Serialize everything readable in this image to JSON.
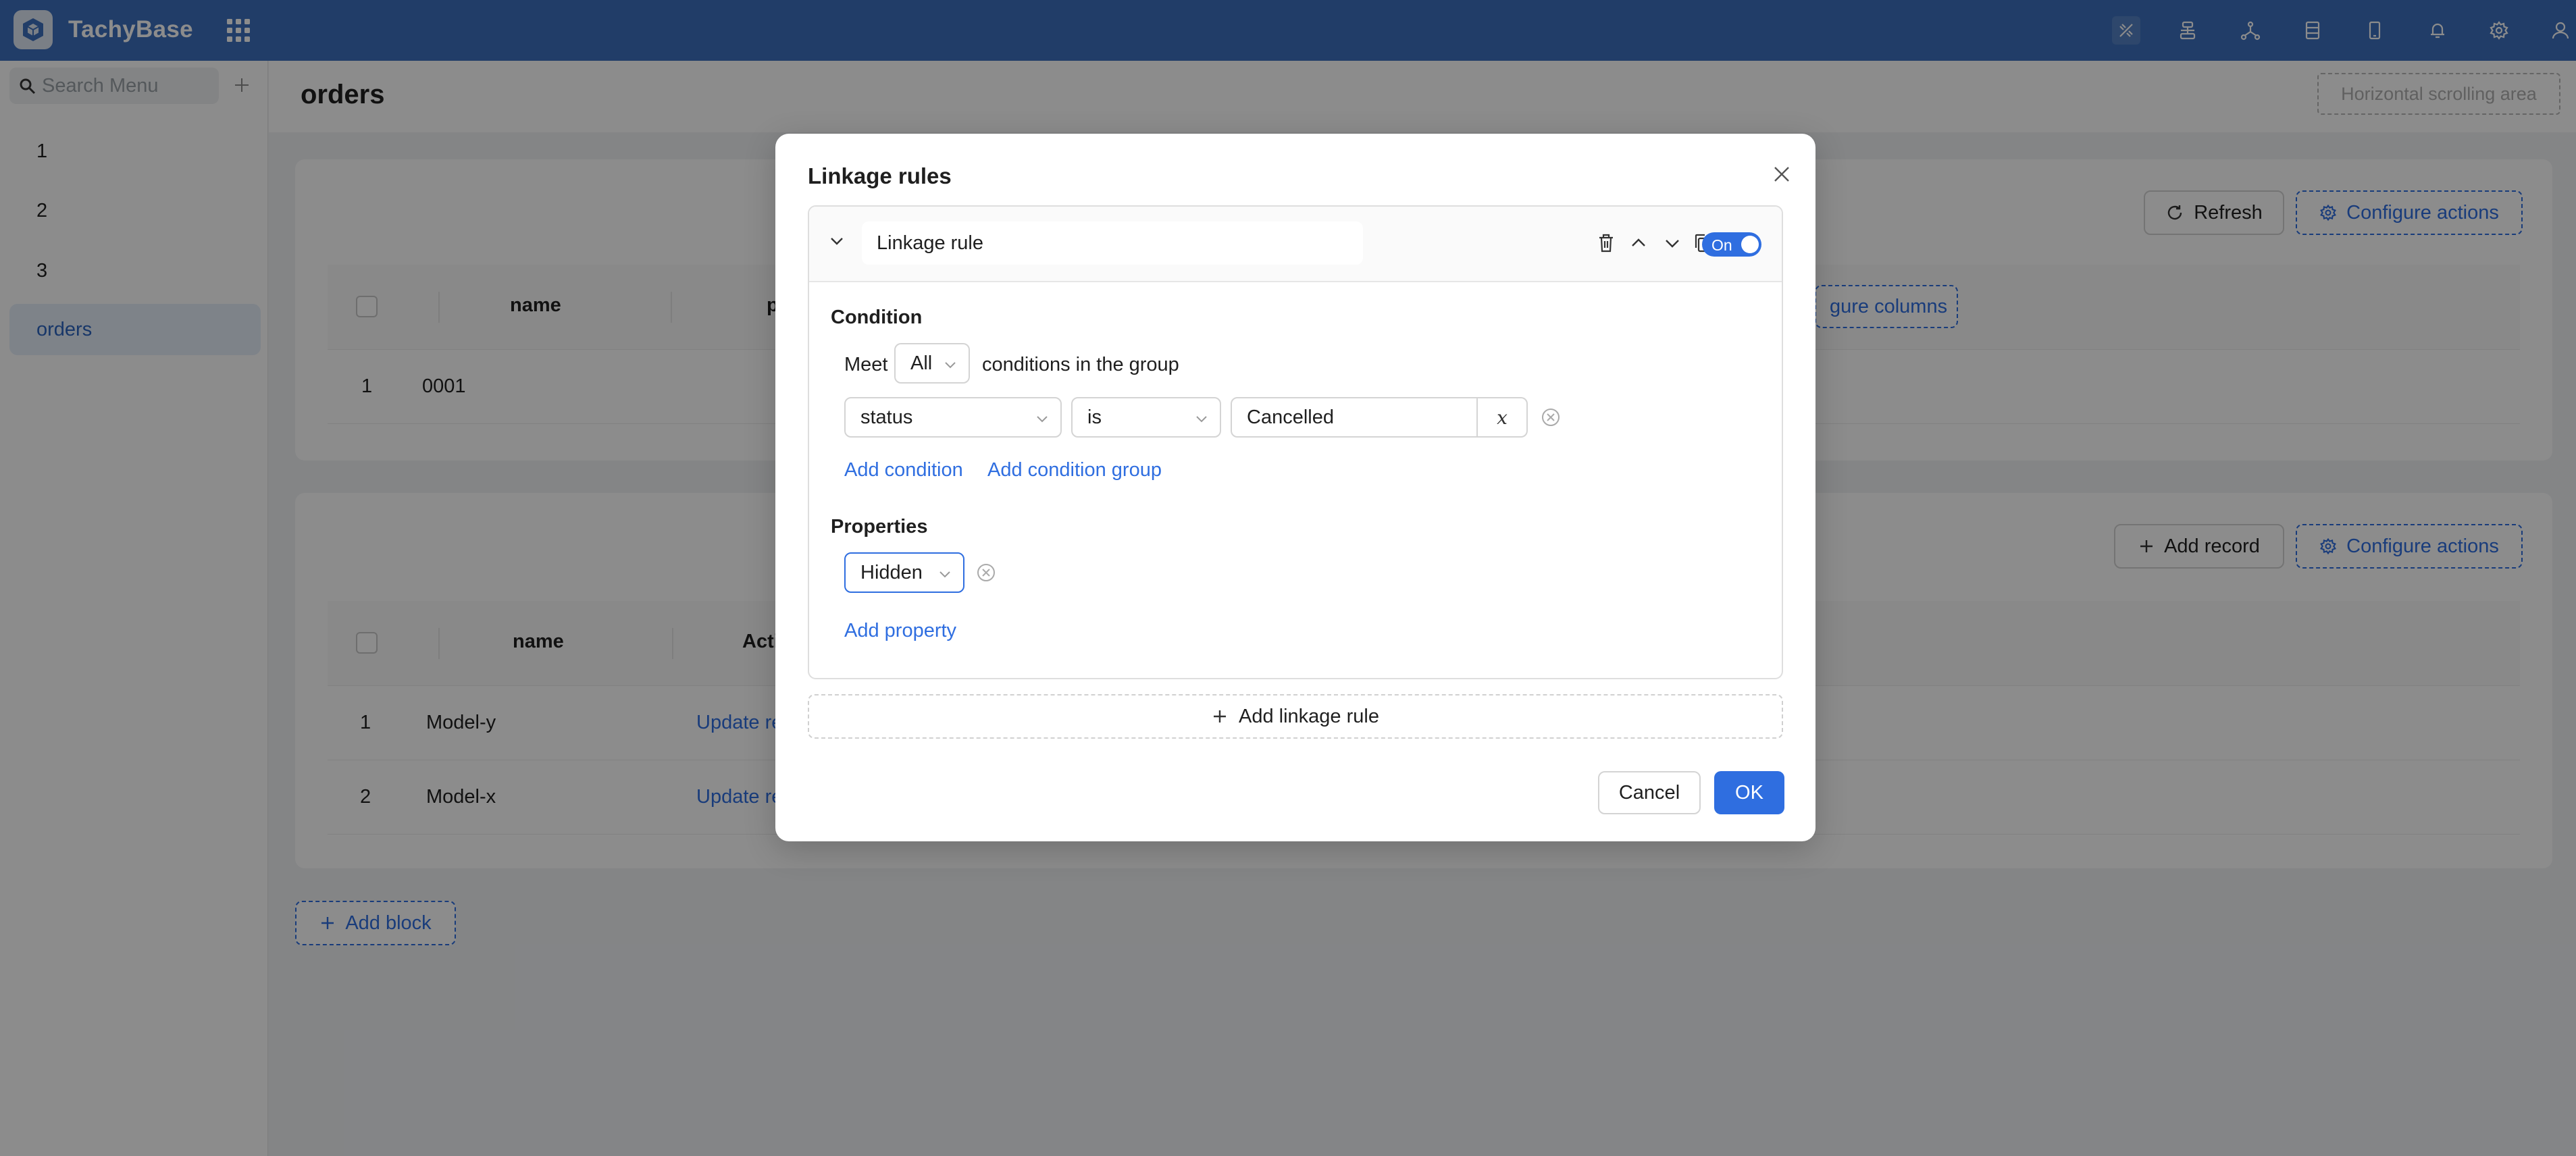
{
  "app": {
    "brand": "TachyBase"
  },
  "header": {
    "icons": [
      "plugin-icon",
      "workflow-icon",
      "graph-icon",
      "datasource-icon",
      "mobile-icon",
      "bell-icon",
      "gear-icon",
      "user-icon"
    ]
  },
  "sidebar": {
    "search_placeholder": "Search Menu",
    "items": [
      {
        "label": "1"
      },
      {
        "label": "2"
      },
      {
        "label": "3"
      },
      {
        "label": "orders"
      }
    ]
  },
  "page": {
    "title": "orders",
    "hscroll_label": "Horizontal scrolling area",
    "add_block": "Add block"
  },
  "block1": {
    "refresh": "Refresh",
    "configure_actions": "Configure actions",
    "configure_columns": "gure columns",
    "col_name": "name",
    "col_partial": "p",
    "rows": [
      {
        "index": "1",
        "name": "0001"
      }
    ]
  },
  "block2": {
    "add_record": "Add record",
    "configure_actions": "Configure actions",
    "col_name": "name",
    "col_actions": "Acti",
    "rows": [
      {
        "index": "1",
        "name": "Model-y",
        "action": "Update re"
      },
      {
        "index": "2",
        "name": "Model-x",
        "action": "Update re"
      }
    ]
  },
  "modal": {
    "title": "Linkage rules",
    "rule": {
      "name": "Linkage rule",
      "toggle_label": "On",
      "condition_label": "Condition",
      "meet": "Meet",
      "meet_value": "All",
      "conditions_suffix": "conditions in the group",
      "field": "status",
      "operator": "is",
      "value": "Cancelled",
      "variable_symbol": "x",
      "add_condition": "Add condition",
      "add_condition_group": "Add condition group",
      "properties_label": "Properties",
      "property_value": "Hidden",
      "add_property": "Add property"
    },
    "add_linkage_rule": "Add linkage rule",
    "cancel": "Cancel",
    "ok": "OK"
  }
}
